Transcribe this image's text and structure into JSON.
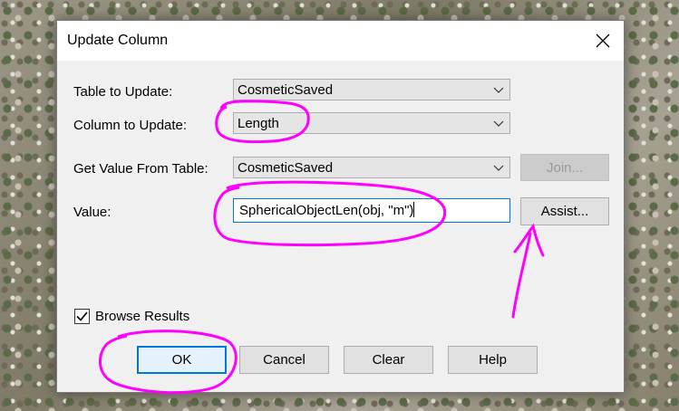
{
  "dialog": {
    "title": "Update Column",
    "fields": {
      "table_label": "Table to Update:",
      "table_value": "CosmeticSaved",
      "column_label": "Column to Update:",
      "column_value": "Length",
      "source_label": "Get Value From Table:",
      "source_value": "CosmeticSaved",
      "value_label": "Value:",
      "value_text": "SphericalObjectLen(obj, \"m\")"
    },
    "buttons": {
      "join": "Join...",
      "assist": "Assist...",
      "ok": "OK",
      "cancel": "Cancel",
      "clear": "Clear",
      "help": "Help"
    },
    "browse_results": {
      "label": "Browse Results",
      "checked": true
    }
  },
  "colors": {
    "highlight_annotation": "#ff00ff",
    "focus_border": "#0078d7"
  }
}
